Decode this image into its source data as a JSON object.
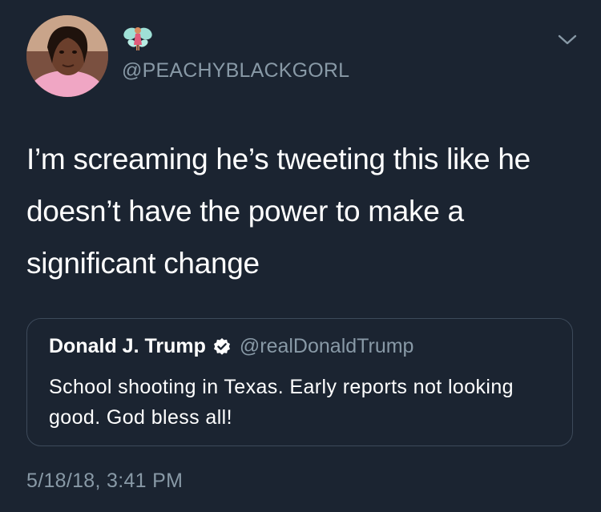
{
  "author": {
    "avatar_icon": "profile-avatar",
    "display_name_icon": "fairy-emoji-icon",
    "handle": "@PEACHYBLACKGORL"
  },
  "menu": {
    "icon": "chevron-down-icon"
  },
  "tweet": {
    "text": "I’m screaming he’s tweeting this like he doesn’t have the power to make a significant change"
  },
  "quoted_tweet": {
    "name": "Donald J. Trump",
    "verified_icon": "verified-badge-icon",
    "handle": "@realDonaldTrump",
    "text": "School shooting in Texas. Early reports not looking good. God bless all!"
  },
  "timestamp": "5/18/18, 3:41 PM",
  "colors": {
    "background": "#1b2431",
    "text_primary": "#ffffff",
    "text_secondary": "#8899a6",
    "card_border": "#3d4a5a"
  }
}
